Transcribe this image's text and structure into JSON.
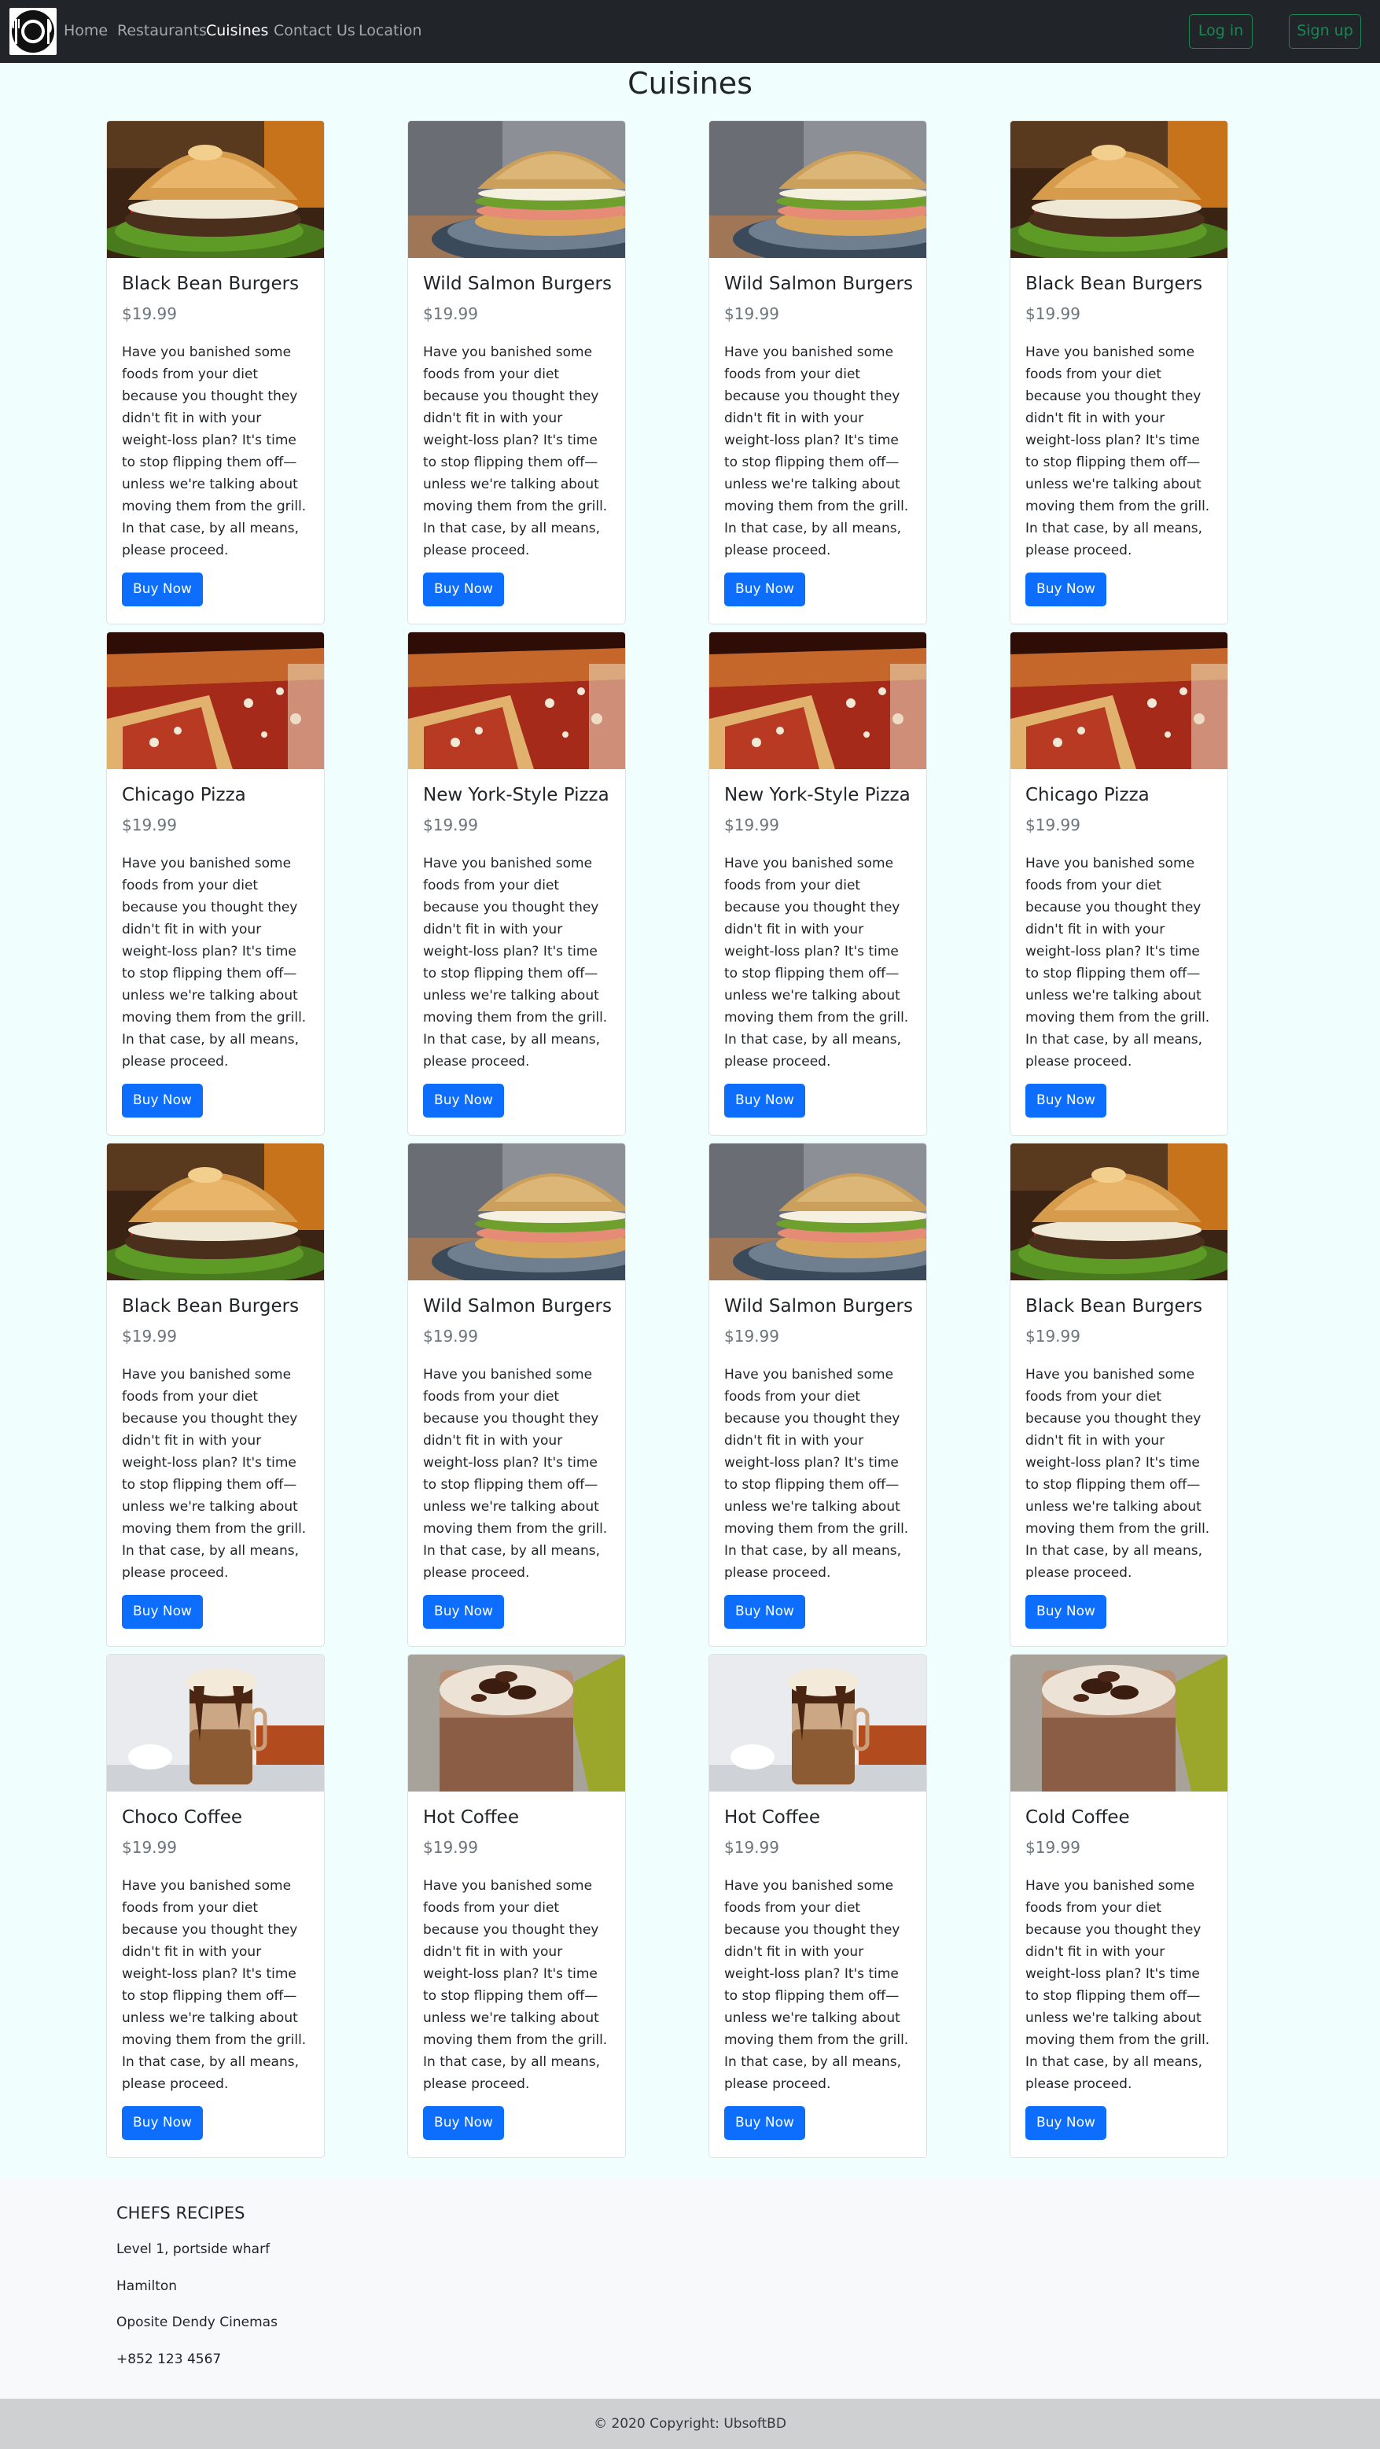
{
  "navbar": {
    "logo_icon": "plate-fork-knife-icon",
    "links": [
      "Home",
      "Restaurants",
      "Cuisines",
      "Contact Us",
      "Location"
    ],
    "active_link": "Cuisines",
    "login_label": "Log in",
    "signup_label": "Sign up",
    "accent_color": "#198754"
  },
  "page_title": "Cuisines",
  "card_description": "Have you banished some foods from your diet because you thought they didn't fit in with your weight-loss plan? It's time to stop flipping them off—unless we're talking about moving them from the grill. In that case, by all means, please proceed.",
  "button_color": "#0d6efd",
  "cards": [
    {
      "title": "Black Bean Burgers",
      "price": "$19.99",
      "button": "Buy Now",
      "image": "bean-burger-image"
    },
    {
      "title": "Wild Salmon Burgers",
      "price": "$19.99",
      "button": "Buy Now",
      "image": "salmon-burger-image"
    },
    {
      "title": "Wild Salmon Burgers",
      "price": "$19.99",
      "button": "Buy Now",
      "image": "salmon-burger-image"
    },
    {
      "title": "Black Bean Burgers",
      "price": "$19.99",
      "button": "Buy Now",
      "image": "bean-burger-image"
    },
    {
      "title": "Chicago Pizza",
      "price": "$19.99",
      "button": "Buy Now",
      "image": "pizza-image"
    },
    {
      "title": "New York-Style Pizza",
      "price": "$19.99",
      "button": "Buy Now",
      "image": "pizza-image"
    },
    {
      "title": "New York-Style Pizza",
      "price": "$19.99",
      "button": "Buy Now",
      "image": "pizza-image"
    },
    {
      "title": "Chicago Pizza",
      "price": "$19.99",
      "button": "Buy Now",
      "image": "pizza-image"
    },
    {
      "title": "Black Bean Burgers",
      "price": "$19.99",
      "button": "Buy Now",
      "image": "bean-burger-image"
    },
    {
      "title": "Wild Salmon Burgers",
      "price": "$19.99",
      "button": "Buy Now",
      "image": "salmon-burger-image"
    },
    {
      "title": "Wild Salmon Burgers",
      "price": "$19.99",
      "button": "Buy Now",
      "image": "salmon-burger-image"
    },
    {
      "title": "Black Bean Burgers",
      "price": "$19.99",
      "button": "Buy Now",
      "image": "bean-burger-image"
    },
    {
      "title": "Choco Coffee",
      "price": "$19.99",
      "button": "Buy Now",
      "image": "choco-coffee-image"
    },
    {
      "title": "Hot Coffee",
      "price": "$19.99",
      "button": "Buy Now",
      "image": "iced-coffee-image"
    },
    {
      "title": "Hot Coffee",
      "price": "$19.99",
      "button": "Buy Now",
      "image": "choco-coffee-image"
    },
    {
      "title": "Cold Coffee",
      "price": "$19.99",
      "button": "Buy Now",
      "image": "iced-coffee-image"
    }
  ],
  "footer": {
    "heading": "CHEFS RECIPES",
    "lines": [
      "Level 1, portside wharf",
      "Hamilton",
      "Oposite Dendy Cinemas",
      "+852 123 4567"
    ]
  },
  "copyright": "© 2020 Copyright: UbsoftBD"
}
